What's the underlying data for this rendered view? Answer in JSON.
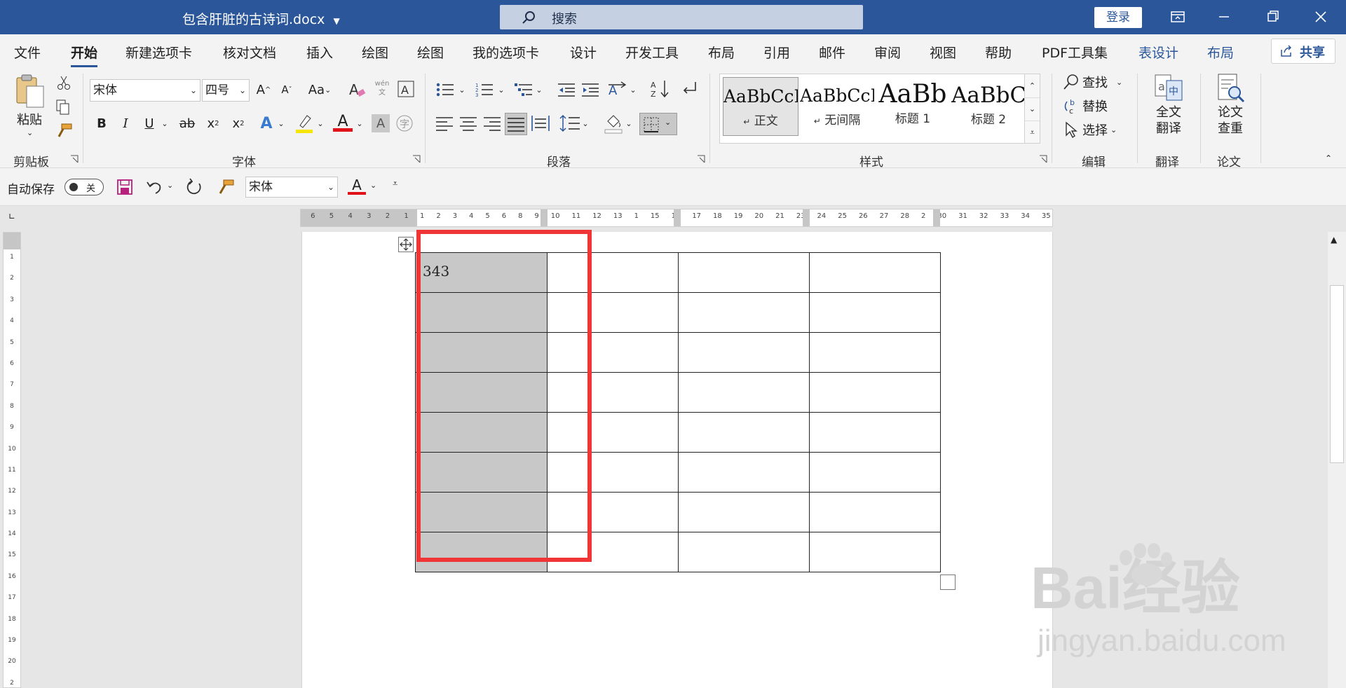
{
  "titlebar": {
    "doc_title": "包含肝脏的古诗词.docx",
    "search_placeholder": "搜索",
    "login_label": "登录"
  },
  "tabs": [
    {
      "label": "文件"
    },
    {
      "label": "开始",
      "active": true
    },
    {
      "label": "新建选项卡"
    },
    {
      "label": "核对文档"
    },
    {
      "label": "插入"
    },
    {
      "label": "绘图"
    },
    {
      "label": "绘图"
    },
    {
      "label": "我的选项卡"
    },
    {
      "label": "设计"
    },
    {
      "label": "开发工具"
    },
    {
      "label": "布局"
    },
    {
      "label": "引用"
    },
    {
      "label": "邮件"
    },
    {
      "label": "审阅"
    },
    {
      "label": "视图"
    },
    {
      "label": "帮助"
    },
    {
      "label": "PDF工具集"
    },
    {
      "label": "表设计",
      "contextual": true
    },
    {
      "label": "布局",
      "contextual": true
    }
  ],
  "share_label": "共享",
  "ribbon": {
    "clipboard": {
      "group_label": "剪贴板",
      "paste_label": "粘贴"
    },
    "font": {
      "group_label": "字体",
      "font_name": "宋体",
      "font_size": "四号",
      "aa_label": "Aa",
      "pinyin_label": "wén 文"
    },
    "paragraph": {
      "group_label": "段落"
    },
    "styles": {
      "group_label": "样式",
      "items": [
        {
          "sample": "AaBbCcI",
          "name": "正文",
          "selected": true
        },
        {
          "sample": "AaBbCcI",
          "name": "无间隔"
        },
        {
          "sample": "AaBb",
          "name": "标题 1"
        },
        {
          "sample": "AaBbC",
          "name": "标题 2"
        }
      ]
    },
    "editing": {
      "group_label": "编辑",
      "find_label": "查找",
      "replace_label": "替换",
      "select_label": "选择"
    },
    "translate": {
      "group_label": "翻译",
      "full_translate_line1": "全文",
      "full_translate_line2": "翻译"
    },
    "paper": {
      "group_label": "论文",
      "check_line1": "论文",
      "check_line2": "查重"
    }
  },
  "qat": {
    "autosave_label": "自动保存",
    "autosave_state": "关",
    "font_name": "宋体"
  },
  "ruler": {
    "h_left_numbers": [
      "6",
      "5",
      "4",
      "3",
      "2",
      "1"
    ],
    "h_right_numbers": [
      "1",
      "2",
      "3",
      "4",
      "5",
      "6",
      "8",
      "9",
      "10",
      "11",
      "12",
      "13",
      "1",
      "15",
      "16",
      "17",
      "18",
      "19",
      "20",
      "21",
      "23",
      "24",
      "25",
      "26",
      "27",
      "28",
      "2",
      "30",
      "31",
      "32",
      "33",
      "34",
      "35"
    ],
    "v_numbers": [
      "1",
      "2",
      "3",
      "4",
      "5",
      "6",
      "7",
      "8",
      "9",
      "10",
      "11",
      "12",
      "13",
      "14",
      "15",
      "16",
      "17",
      "18",
      "19",
      "20",
      "2"
    ]
  },
  "document": {
    "table": {
      "rows": 8,
      "cols": 4,
      "first_cell_text": "343",
      "selected_column": 1
    }
  },
  "annotation": {
    "color": "#ef3535"
  },
  "watermark": {
    "brand_text": "Bai经验",
    "url_text": "jingyan.baidu.com"
  },
  "colors": {
    "titlebar": "#2b579a",
    "ribbon": "#f3f3f3",
    "selection": "#c8c8c8",
    "highlight_red": "#ef3535"
  }
}
